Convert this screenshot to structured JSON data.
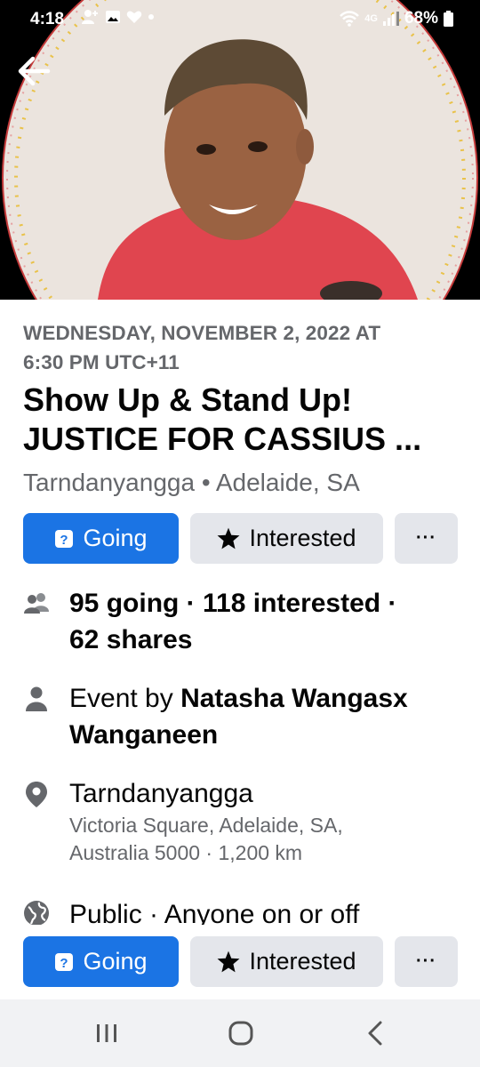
{
  "status_bar": {
    "time": "4:18",
    "network": "4G",
    "battery": "68%"
  },
  "event": {
    "date_line1": "WEDNESDAY, NOVEMBER 2, 2022 AT",
    "date_line2": "6:30 PM UTC+11",
    "title_line1": "Show Up & Stand Up!",
    "title_line2": "JUSTICE FOR CASSIUS ...",
    "location": "Tarndanyangga • Adelaide, SA"
  },
  "actions": {
    "going_label": "Going",
    "interested_label": "Interested",
    "more_label": "···"
  },
  "details": {
    "stats_line1": "95 going · 118 interested ·",
    "stats_line2": "62 shares",
    "host_prefix": "Event by ",
    "host_name_part1": "Natasha Wangasx",
    "host_name_part2": "Wanganeen",
    "place_name": "Tarndanyangga",
    "place_address_line1": "Victoria Square, Adelaide, SA,",
    "place_address_line2": "Australia 5000 · 1,200 km",
    "privacy": "Public · Anyone on or off"
  },
  "colors": {
    "primary_blue": "#1b74e4",
    "button_gray": "#e4e6eb",
    "secondary_text": "#65676b",
    "cover_border": "#d9534f"
  },
  "icons": {
    "back": "arrow-left-icon",
    "going": "going-badge-icon",
    "interested": "star-icon",
    "stats": "people-icon",
    "host": "person-icon",
    "location": "map-pin-icon",
    "privacy": "globe-icon"
  }
}
